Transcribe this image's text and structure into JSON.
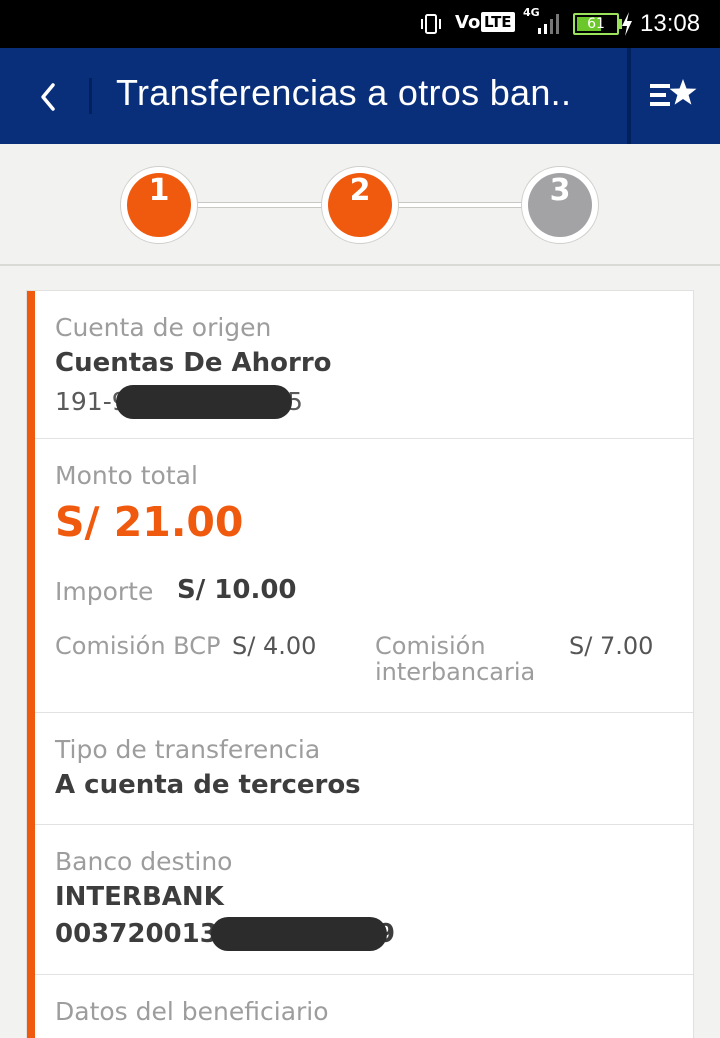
{
  "status_bar": {
    "network_volte": "Vo",
    "network_lte": "LTE",
    "network_gen": "4G",
    "battery": "61",
    "time": "13:08"
  },
  "header": {
    "title": "Transferencias a otros ban..",
    "back_icon": "chevron-left-icon",
    "favorites_icon": "list-star-icon",
    "background": "#0a2f7a"
  },
  "stepper": {
    "steps": [
      {
        "label": "1",
        "state": "active"
      },
      {
        "label": "2",
        "state": "active"
      },
      {
        "label": "3",
        "state": "pending"
      }
    ],
    "active_color": "#f05a0f",
    "pending_color": "#a3a3a6"
  },
  "origin": {
    "label": "Cuenta de origen",
    "account_type": "Cuentas De Ahorro",
    "account_prefix": "191-9",
    "account_suffix": "5"
  },
  "amounts": {
    "total_label": "Monto total",
    "total_value": "S/ 21.00",
    "importe_label": "Importe",
    "importe_value": "S/ 10.00",
    "bcp_fee_label": "Comisión BCP",
    "bcp_fee_value": "S/ 4.00",
    "interbank_fee_label_1": "Comisión",
    "interbank_fee_label_2": "interbancaria",
    "interbank_fee_value": "S/ 7.00"
  },
  "transfer_type": {
    "label": "Tipo de transferencia",
    "value": "A cuenta de terceros"
  },
  "destination": {
    "label": "Banco destino",
    "bank": "INTERBANK",
    "account_prefix": "003720013",
    "account_suffix": "9"
  },
  "beneficiary": {
    "label": "Datos del beneficiario"
  },
  "accent_color": "#f05a0f"
}
